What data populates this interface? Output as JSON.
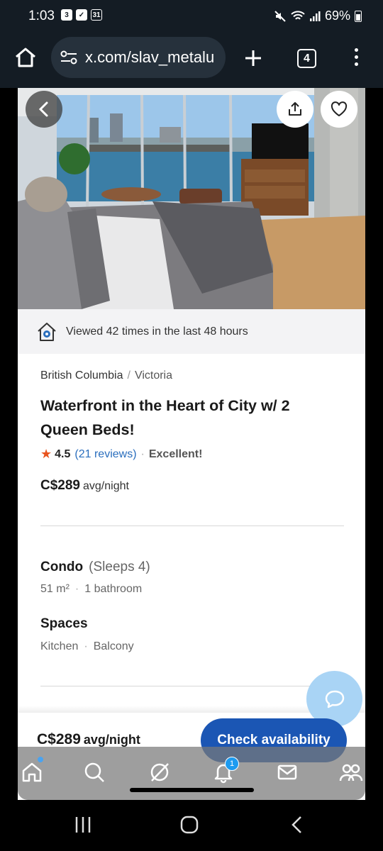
{
  "status_bar": {
    "time": "1:03",
    "notif_1": "3",
    "notif_3": "31",
    "battery": "69%"
  },
  "browser": {
    "url": "x.com/slav_metalu",
    "tab_count": "4"
  },
  "hero": {
    "back_icon": "chevron-left-icon",
    "share_icon": "share-icon",
    "fav_icon": "heart-icon"
  },
  "viewed": {
    "text": "Viewed 42 times in the last 48 hours"
  },
  "listing": {
    "breadcrumb": [
      "British Columbia",
      "Victoria"
    ],
    "breadcrumb_sep": "/",
    "title": "Waterfront in the Heart of City w/ 2 Queen Beds!",
    "rating": "4.5",
    "reviews": "(21 reviews)",
    "rating_label": "Excellent!",
    "price": "C$289",
    "price_unit": "avg/night",
    "type": "Condo",
    "sleeps": "(Sleeps 4)",
    "area": "51 m²",
    "bathrooms": "1 bathroom",
    "spaces_title": "Spaces",
    "spaces": [
      "Kitchen",
      "Balcony"
    ]
  },
  "footer": {
    "price": "C$289",
    "price_unit": "avg/night",
    "cta": "Check availability"
  },
  "app_nav": {
    "notif_count": "1",
    "items": [
      "home-icon",
      "search-icon",
      "grok-icon",
      "bell-icon",
      "mail-icon",
      "communities-icon"
    ]
  },
  "colors": {
    "accent": "#1b56b4",
    "star": "#e8541e",
    "link": "#2a6ebd"
  }
}
